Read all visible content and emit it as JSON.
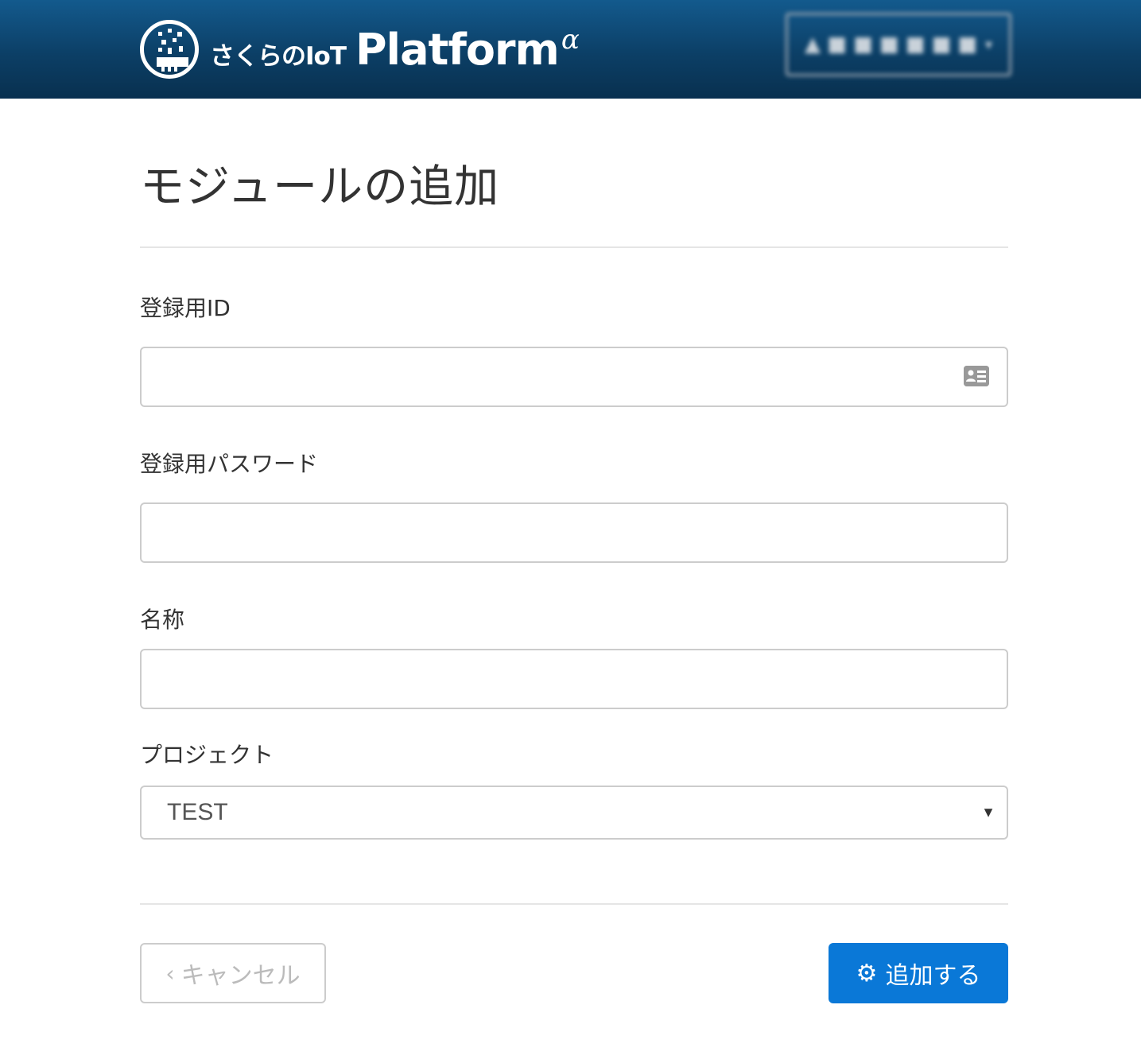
{
  "header": {
    "logo_jp": "さくらのIoT",
    "logo_en": "Platform",
    "logo_alpha": "α",
    "user_menu_label": "▲ ■ ■ ■ ■ ■ ■"
  },
  "page": {
    "title": "モジュールの追加"
  },
  "form": {
    "registration_id": {
      "label": "登録用ID",
      "value": "",
      "icon": "id-card-icon"
    },
    "registration_password": {
      "label": "登録用パスワード",
      "value": ""
    },
    "name": {
      "label": "名称",
      "value": ""
    },
    "project": {
      "label": "プロジェクト",
      "selected": "TEST"
    }
  },
  "actions": {
    "cancel_label": "キャンセル",
    "cancel_icon": "chevron-left-icon",
    "add_label": "追加する",
    "add_icon": "gear-icon"
  },
  "colors": {
    "header_top": "#135a8d",
    "header_bottom": "#08304f",
    "primary_button": "#0a78d7",
    "text": "#333333",
    "border": "#cccccc"
  }
}
